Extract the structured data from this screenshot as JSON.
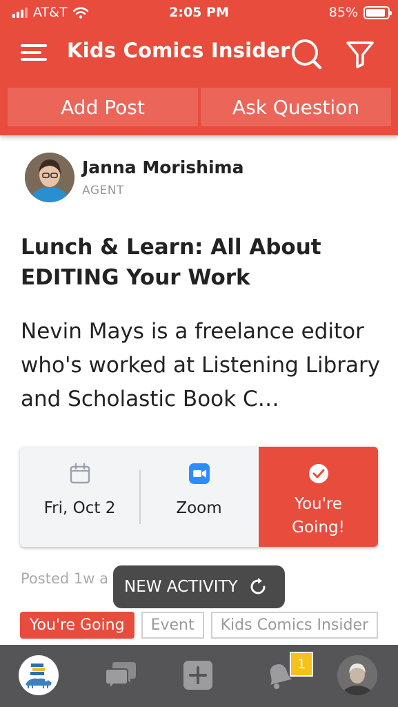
{
  "status_bar": {
    "carrier": "AT&T",
    "time": "2:05 PM",
    "battery": "85%"
  },
  "header": {
    "title": "Kids Comics Insider",
    "add_post": "Add Post",
    "ask_question": "Ask Question"
  },
  "post": {
    "author_name": "Janna Morishima",
    "author_role": "AGENT",
    "title": "Lunch & Learn: All About EDITING Your Work",
    "body": "Nevin Mays is a freelance editor who's worked at Listening Library and Scholastic Book C…",
    "event": {
      "date": "Fri, Oct 2",
      "location": "Zoom",
      "rsvp_line1": "You're",
      "rsvp_line2": "Going!"
    },
    "posted": "Posted 1w a",
    "tags": [
      "You're Going",
      "Event",
      "Kids Comics Insider"
    ]
  },
  "toast": {
    "label": "NEW ACTIVITY"
  },
  "tabbar": {
    "notifications_badge": "1"
  },
  "colors": {
    "brand": "#e84c3d",
    "tabbar": "#555557",
    "badge": "#f5c21b",
    "zoom": "#2d8cff"
  }
}
